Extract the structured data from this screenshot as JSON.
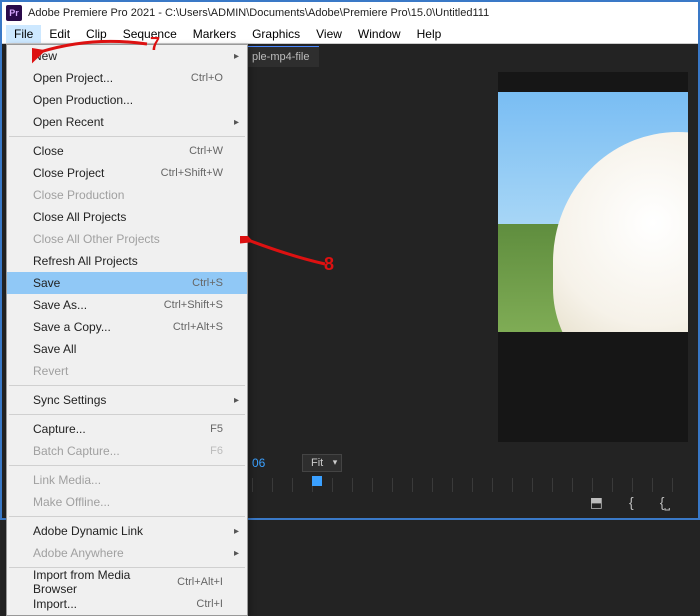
{
  "titlebar": {
    "app_icon": "Pr",
    "title": "Adobe Premiere Pro 2021 - C:\\Users\\ADMIN\\Documents\\Adobe\\Premiere Pro\\15.0\\Untitled111"
  },
  "menubar": {
    "items": [
      "File",
      "Edit",
      "Clip",
      "Sequence",
      "Markers",
      "Graphics",
      "View",
      "Window",
      "Help"
    ],
    "active_index": 0
  },
  "tab": {
    "label": "ple-mp4-file"
  },
  "time_display": "06",
  "fit_selector": {
    "label": "Fit"
  },
  "transport_icons": [
    "prev",
    "step",
    "bracket"
  ],
  "annotations": {
    "seven": "7",
    "eight": "8"
  },
  "file_menu": [
    {
      "type": "item",
      "label": "New",
      "submenu": true
    },
    {
      "type": "item",
      "label": "Open Project...",
      "shortcut": "Ctrl+O"
    },
    {
      "type": "item",
      "label": "Open Production..."
    },
    {
      "type": "item",
      "label": "Open Recent",
      "submenu": true
    },
    {
      "type": "sep"
    },
    {
      "type": "item",
      "label": "Close",
      "shortcut": "Ctrl+W"
    },
    {
      "type": "item",
      "label": "Close Project",
      "shortcut": "Ctrl+Shift+W"
    },
    {
      "type": "item",
      "label": "Close Production",
      "disabled": true
    },
    {
      "type": "item",
      "label": "Close All Projects"
    },
    {
      "type": "item",
      "label": "Close All Other Projects",
      "disabled": true
    },
    {
      "type": "item",
      "label": "Refresh All Projects"
    },
    {
      "type": "item",
      "label": "Save",
      "shortcut": "Ctrl+S",
      "highlight": true
    },
    {
      "type": "item",
      "label": "Save As...",
      "shortcut": "Ctrl+Shift+S"
    },
    {
      "type": "item",
      "label": "Save a Copy...",
      "shortcut": "Ctrl+Alt+S"
    },
    {
      "type": "item",
      "label": "Save All"
    },
    {
      "type": "item",
      "label": "Revert",
      "disabled": true
    },
    {
      "type": "sep"
    },
    {
      "type": "item",
      "label": "Sync Settings",
      "submenu": true
    },
    {
      "type": "sep"
    },
    {
      "type": "item",
      "label": "Capture...",
      "shortcut": "F5"
    },
    {
      "type": "item",
      "label": "Batch Capture...",
      "shortcut": "F6",
      "disabled": true
    },
    {
      "type": "sep"
    },
    {
      "type": "item",
      "label": "Link Media...",
      "disabled": true
    },
    {
      "type": "item",
      "label": "Make Offline...",
      "disabled": true
    },
    {
      "type": "sep"
    },
    {
      "type": "item",
      "label": "Adobe Dynamic Link",
      "submenu": true
    },
    {
      "type": "item",
      "label": "Adobe Anywhere",
      "submenu": true,
      "disabled": true
    },
    {
      "type": "sep"
    },
    {
      "type": "item",
      "label": "Import from Media Browser",
      "shortcut": "Ctrl+Alt+I"
    },
    {
      "type": "item",
      "label": "Import...",
      "shortcut": "Ctrl+I"
    }
  ]
}
